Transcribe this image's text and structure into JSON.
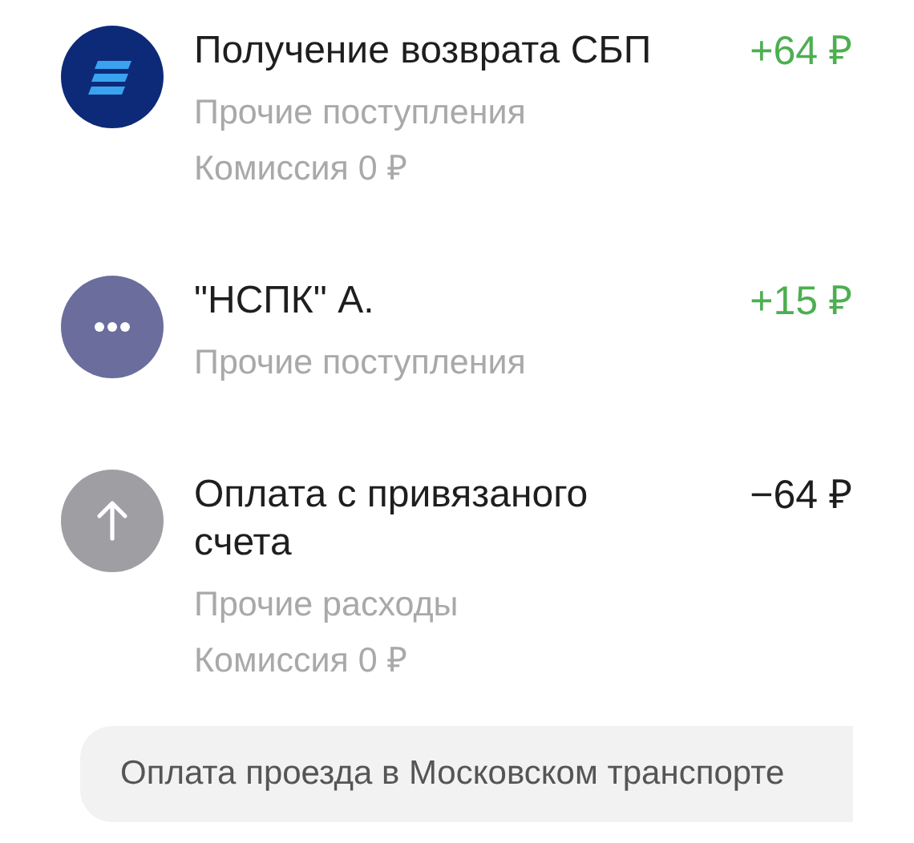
{
  "transactions": [
    {
      "kind": "sbp",
      "title": "Получение возврата СБП",
      "amount": "+64 ₽",
      "category": "Прочие поступления",
      "commission": "Комиссия 0 ₽"
    },
    {
      "kind": "other",
      "title": "\"НСПК\" А.",
      "amount": "+15 ₽",
      "category": "Прочие поступления"
    },
    {
      "kind": "outgoing",
      "title": "Оплата с привязаного счета",
      "amount": "−64 ₽",
      "category": "Прочие расходы",
      "commission": "Комиссия 0 ₽"
    }
  ],
  "banner": {
    "text": "Оплата проезда в Московском транспорте"
  }
}
